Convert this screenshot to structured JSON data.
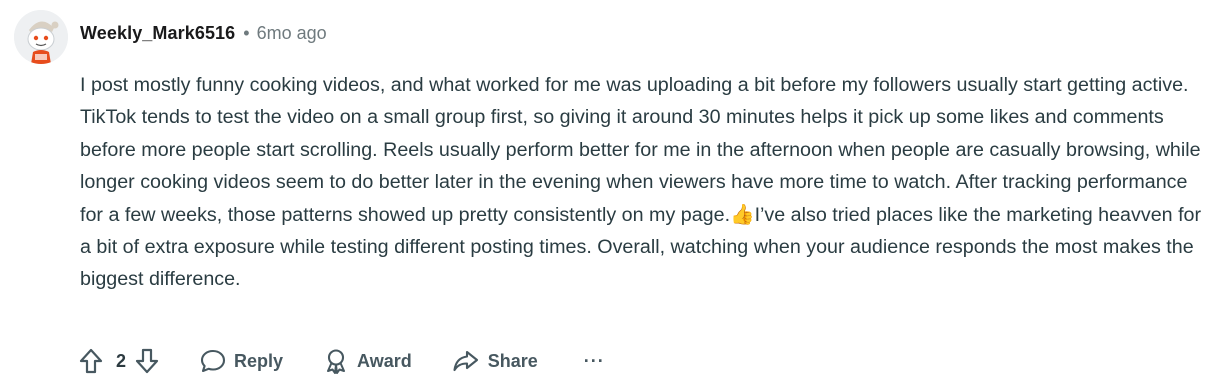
{
  "comment": {
    "username": "Weekly_Mark6516",
    "separator": "•",
    "timestamp": "6mo ago",
    "body_before_emoji": "I post mostly funny cooking videos, and what worked for me was uploading a bit before my followers usually start getting active. TikTok tends to test the video on a small group first, so giving it around 30 minutes helps it pick up some likes and comments before more people start scrolling. Reels usually perform better for me in the afternoon when people are casually browsing, while longer cooking videos seem to do better later in the evening when viewers have more time to watch. After tracking performance for a few weeks, those patterns showed up pretty consistently on my page.",
    "emoji": "👍",
    "body_after_emoji": "I’ve also tried places like the marketing heavven for a bit of extra exposure while testing different posting times. Overall, watching when your audience responds the most makes the biggest difference."
  },
  "actions": {
    "score": "2",
    "reply_label": "Reply",
    "award_label": "Award",
    "share_label": "Share",
    "more_label": "···"
  },
  "icons": {
    "avatar": "snoo-avatar-icon",
    "upvote": "upvote-arrow-icon",
    "downvote": "downvote-arrow-icon",
    "reply": "speech-bubble-icon",
    "award": "award-medal-icon",
    "share": "share-arrow-icon"
  },
  "colors": {
    "username": "#1a1a1b",
    "meta": "#6f7a7e",
    "body_text": "#2a3c42",
    "action_text": "#475860",
    "avatar_accent": "#e74c1c"
  }
}
